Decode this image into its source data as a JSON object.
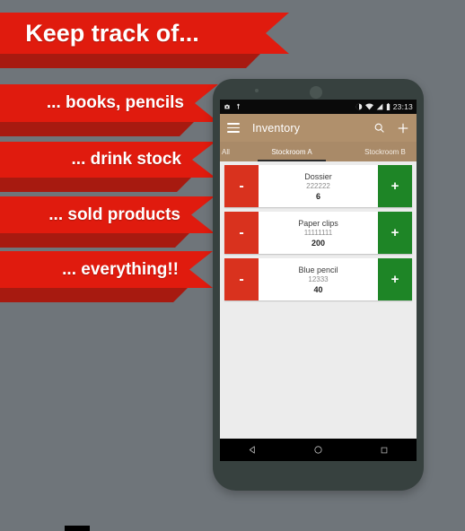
{
  "background_color": "#6f757a",
  "promo": {
    "ribbon_color": "#e01b0e",
    "ribbon_fold_color": "#a71a10",
    "ribbons": [
      {
        "text": "Keep track of..."
      },
      {
        "text": "... books, pencils"
      },
      {
        "text": "... drink stock"
      },
      {
        "text": "... sold products"
      },
      {
        "text": "... everything!!"
      }
    ]
  },
  "phone": {
    "body_color": "#37413f",
    "statusbar": {
      "left_icons": [
        "screenshot-icon",
        "usb-icon"
      ],
      "right_icons": [
        "do-not-disturb-icon",
        "wifi-icon",
        "signal-icon",
        "battery-icon"
      ],
      "time": "23:13"
    },
    "appbar": {
      "menu_icon": "hamburger-icon",
      "title": "Inventory",
      "search_icon": "search-icon",
      "add_icon": "plus-icon",
      "color": "#b0906c"
    },
    "tabs": {
      "items": [
        {
          "label": "All",
          "selected": false
        },
        {
          "label": "Stockroom A",
          "selected": true
        },
        {
          "label": "Stockroom B",
          "selected": false
        }
      ]
    },
    "list": {
      "decrement_label": "-",
      "increment_label": "+",
      "decrement_color": "#d9321e",
      "increment_color": "#1e8526",
      "items": [
        {
          "name": "Dossier",
          "code": "222222",
          "quantity": "6"
        },
        {
          "name": "Paper clips",
          "code": "11111111",
          "quantity": "200"
        },
        {
          "name": "Blue pencil",
          "code": "12333",
          "quantity": "40"
        }
      ]
    },
    "navbar": {
      "back": "back-triangle-icon",
      "home": "home-circle-icon",
      "recents": "recents-square-icon"
    }
  }
}
